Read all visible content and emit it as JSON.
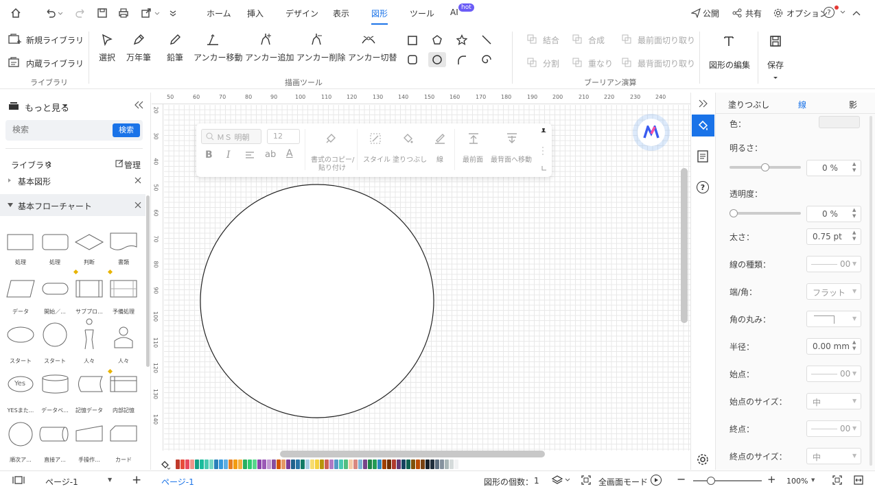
{
  "menubar": {
    "tabs": [
      "ホーム",
      "挿入",
      "デザイン",
      "表示",
      "図形",
      "ツール",
      "AI"
    ],
    "active_tab": "図形",
    "hot_badge": "hot",
    "publish": "公開",
    "share": "共有",
    "options": "オプション",
    "help": "?"
  },
  "ribbon": {
    "library": {
      "new_library": "新規ライブラリ",
      "builtin_library": "内蔵ライブラリ",
      "group_label": "ライブラリ"
    },
    "draw_tools": {
      "select": "選択",
      "pen": "万年筆",
      "pencil": "鉛筆",
      "move_anchor": "アンカー移動",
      "add_anchor": "アンカー追加",
      "delete_anchor": "アンカー削除",
      "switch_anchor": "アンカー切替",
      "group_label": "描画ツール"
    },
    "boolean": {
      "union": "結合",
      "combine": "合成",
      "front_cut": "最前面切り取り",
      "divide": "分割",
      "intersect": "重なり",
      "back_cut": "最背面切り取り",
      "group_label": "ブーリアン演算"
    },
    "edit_shape": "図形の編集",
    "save": "保存"
  },
  "left_panel": {
    "more": "もっと見る",
    "search_placeholder": "検索",
    "search_button": "検索",
    "library_label": "ライブラリ",
    "manage": "管理",
    "basic_shapes": "基本図形",
    "basic_flowchart": "基本フローチャート",
    "shapes": [
      {
        "label": "処理"
      },
      {
        "label": "処理"
      },
      {
        "label": "判断"
      },
      {
        "label": "書類"
      },
      {
        "label": "データ"
      },
      {
        "label": "開始／..."
      },
      {
        "label": "サブプロ..."
      },
      {
        "label": "予備処理"
      },
      {
        "label": "スタート"
      },
      {
        "label": "スタート"
      },
      {
        "label": "人々"
      },
      {
        "label": "人々"
      },
      {
        "label": "YESまた..."
      },
      {
        "label": "データベ..."
      },
      {
        "label": "記憶データ"
      },
      {
        "label": "内部記憶"
      },
      {
        "label": "順次ア..."
      },
      {
        "label": "直接ア..."
      },
      {
        "label": "手操作..."
      },
      {
        "label": "カード"
      }
    ],
    "yes_text": "Yes"
  },
  "rulers": {
    "top": [
      "50",
      "60",
      "70",
      "80",
      "90",
      "100",
      "110",
      "120",
      "130",
      "140",
      "150",
      "160",
      "170",
      "180",
      "190",
      "200",
      "210",
      "220",
      "230",
      "240"
    ],
    "left": [
      "20",
      "30",
      "40",
      "50",
      "60",
      "70",
      "80",
      "90",
      "100",
      "110",
      "120",
      "130",
      "140"
    ]
  },
  "float_toolbar": {
    "font": "ＭＳ 明朝",
    "size": "12",
    "bold": "B",
    "italic": "I",
    "ab": "ab",
    "font_color": "A",
    "copy_format": "書式のコピー/貼り付け",
    "copy_format_1": "書式のコピー/",
    "copy_format_2": "貼り付け",
    "style": "スタイル",
    "fill": "塗りつぶし",
    "line": "線",
    "front": "最前面",
    "back": "最背面へ移動"
  },
  "props": {
    "tabs": [
      "塗りつぶし",
      "線",
      "影"
    ],
    "active_tab": "線",
    "color_label": "色：",
    "brightness_label": "明るさ：",
    "brightness_value": "0 %",
    "transparency_label": "透明度：",
    "transparency_value": "0 %",
    "width_label": "太さ：",
    "width_value": "0.75 pt",
    "line_type_label": "線の種類：",
    "line_type_value": "00",
    "cap_label": "端/角：",
    "cap_value": "フラット",
    "round_label": "角の丸み：",
    "radius_label": "半径：",
    "radius_value": "0.00 mm",
    "start_label": "始点：",
    "start_value": "00",
    "start_size_label": "始点のサイズ：",
    "start_size_value": "中",
    "end_label": "終点：",
    "end_value": "00",
    "end_size_label": "終点のサイズ：",
    "end_size_value": "中"
  },
  "statusbar": {
    "page_select": "ページ-1",
    "page_tab": "ページ-1",
    "shape_count": "図形の個数：",
    "shape_count_value": "1",
    "fullscreen": "全画面モード",
    "zoom": "100%"
  },
  "palette_colors": [
    "#c0392b",
    "#e74c3c",
    "#e84a5f",
    "#f1948a",
    "#16a085",
    "#1abc9c",
    "#48c9b0",
    "#76d7c4",
    "#2980b9",
    "#3498db",
    "#5dade2",
    "#e67e22",
    "#f39c12",
    "#f5b041",
    "#27ae60",
    "#2ecc71",
    "#58d68d",
    "#8e44ad",
    "#9b59b6",
    "#c39bd3",
    "#884ea0",
    "#d35400",
    "#e59866",
    "#7d3c98",
    "#1f618d",
    "#2874a6",
    "#117a65",
    "#a9cce3",
    "#f7dc6f",
    "#f4d03f",
    "#b7950b",
    "#cd6155",
    "#af7ac5",
    "#5499c7",
    "#48c9b0",
    "#52be80",
    "#f5cba7",
    "#d98880",
    "#7fb3d5",
    "#76448a",
    "#1e8449",
    "#239b56",
    "#2e86c1",
    "#a04000",
    "#6e2c00",
    "#b03a2e",
    "#633974",
    "#154360",
    "#0e6251",
    "#7e5109",
    "#ba4a00",
    "#784212",
    "#17202a",
    "#212f3d",
    "#5d6d7e",
    "#85929e",
    "#aab7b8",
    "#d5dbdb",
    "#f2f3f4"
  ],
  "colors": {
    "accent": "#1a73e8",
    "selected_tool_bg": "#e6e6e6"
  }
}
